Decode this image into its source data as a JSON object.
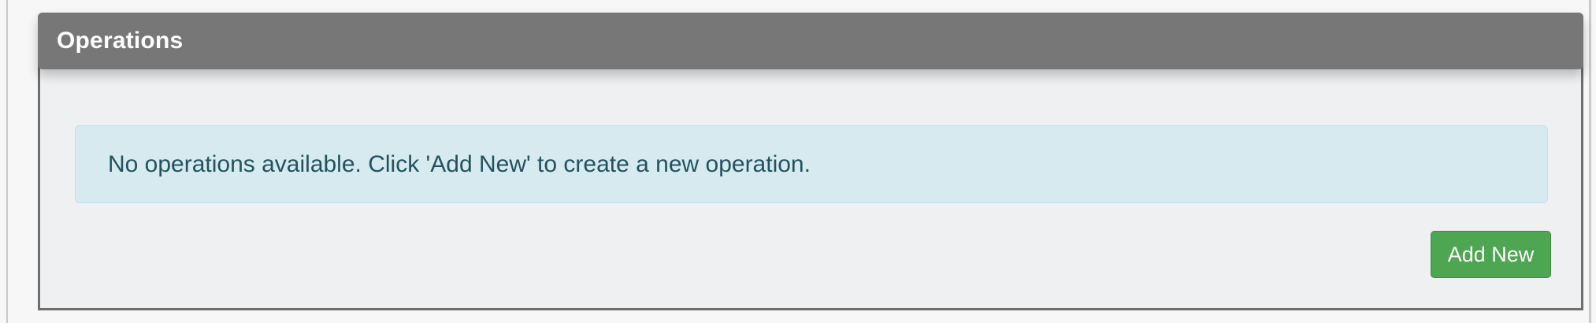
{
  "panel": {
    "title": "Operations",
    "empty_message": "No operations available. Click 'Add New' to create a new operation.",
    "add_button_label": "Add New"
  },
  "colors": {
    "header_bg": "#777777",
    "panel_bg": "#eef0f2",
    "alert_bg": "#d6eaf0",
    "alert_text": "#23525e",
    "button_bg": "#4fa652"
  }
}
